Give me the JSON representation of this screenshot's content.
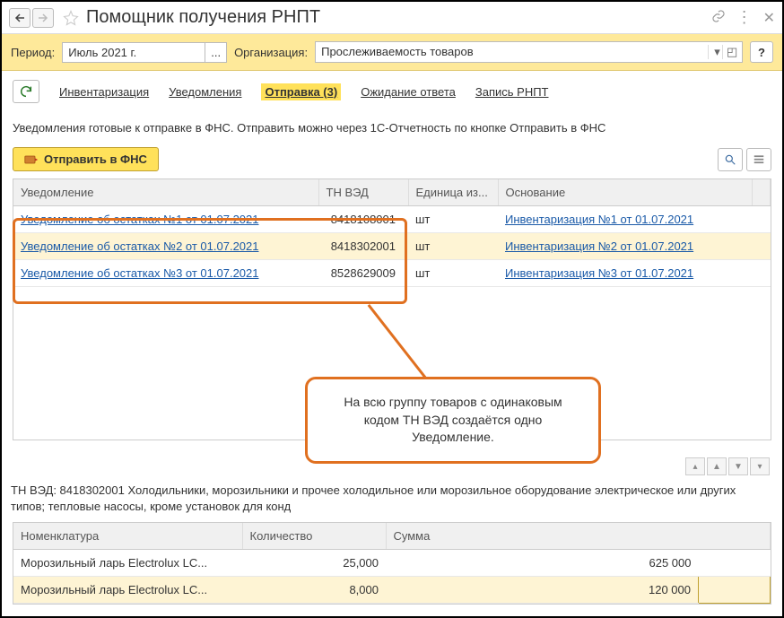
{
  "title": "Помощник получения РНПТ",
  "period": {
    "label": "Период:",
    "value": "Июль 2021 г."
  },
  "org": {
    "label": "Организация:",
    "value": "Прослеживаемость товаров"
  },
  "tabs": {
    "inventory": "Инвентаризация",
    "notifications": "Уведомления",
    "sending": "Отправка (3)",
    "waiting": "Ожидание ответа",
    "record": "Запись РНПТ"
  },
  "description": "Уведомления готовые к отправке в ФНС. Отправить можно через 1С-Отчетность по кнопке Отправить в ФНС",
  "send_button": "Отправить в ФНС",
  "help_label": "?",
  "columns": {
    "notice": "Уведомление",
    "tnved": "ТН ВЭД",
    "unit": "Единица из...",
    "basis": "Основание"
  },
  "rows": [
    {
      "notice": "Уведомление об остатках №1 от 01.07.2021",
      "tnved": "8418108001",
      "unit": "шт",
      "basis": "Инвентаризация №1 от 01.07.2021"
    },
    {
      "notice": "Уведомление об остатках №2 от 01.07.2021",
      "tnved": "8418302001",
      "unit": "шт",
      "basis": "Инвентаризация №2 от 01.07.2021"
    },
    {
      "notice": "Уведомление об остатках №3 от 01.07.2021",
      "tnved": "8528629009",
      "unit": "шт",
      "basis": "Инвентаризация №3 от 01.07.2021"
    }
  ],
  "callout_text": "На всю группу товаров с одинаковым кодом ТН ВЭД создаётся одно Уведомление.",
  "detail_text": "ТН ВЭД: 8418302001 Холодильники, морозильники и прочее холодильное или морозильное оборудование электрическое или других типов; тепловые насосы, кроме установок для конд",
  "detail_columns": {
    "nomenclature": "Номенклатура",
    "qty": "Количество",
    "sum": "Сумма"
  },
  "detail_rows": [
    {
      "nomenclature": "Морозильный ларь Electrolux LC...",
      "qty": "25,000",
      "sum": "625 000"
    },
    {
      "nomenclature": "Морозильный ларь Electrolux LC...",
      "qty": "8,000",
      "sum": "120 000"
    }
  ]
}
